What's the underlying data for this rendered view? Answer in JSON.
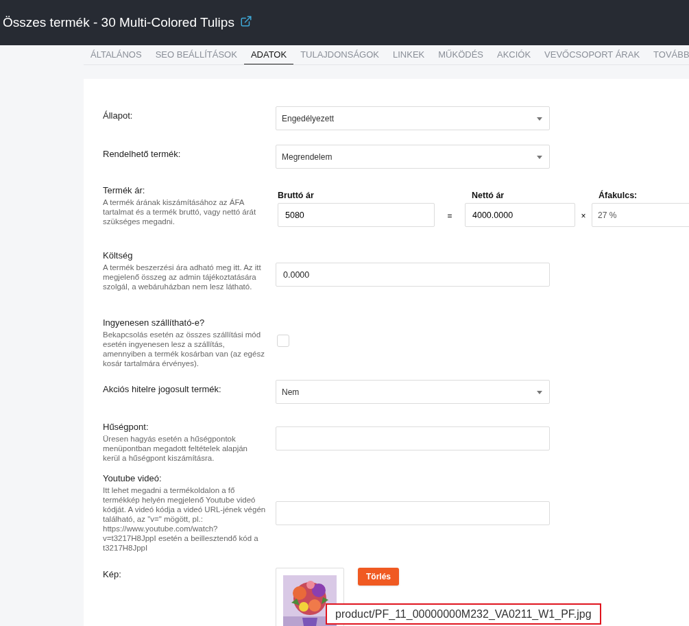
{
  "header": {
    "title": "Összes termék - 30 Multi-Colored Tulips"
  },
  "tabs": [
    {
      "label": "ÁLTALÁNOS",
      "selected": false
    },
    {
      "label": "SEO BEÁLLÍTÁSOK",
      "selected": false
    },
    {
      "label": "ADATOK",
      "selected": true
    },
    {
      "label": "TULAJDONSÁGOK",
      "selected": false
    },
    {
      "label": "LINKEK",
      "selected": false
    },
    {
      "label": "MŰKÖDÉS",
      "selected": false
    },
    {
      "label": "AKCIÓK",
      "selected": false
    },
    {
      "label": "VEVŐCSOPORT ÁRAK",
      "selected": false
    },
    {
      "label": "TOVÁBB",
      "selected": false
    }
  ],
  "fields": [
    {
      "kind": "select",
      "label": "Állapot:",
      "value": "Engedélyezett"
    },
    {
      "kind": "select",
      "label": "Rendelhető termék:",
      "value": "Megrendelem"
    },
    {
      "kind": "price",
      "label": "Termék ár:",
      "help": "A termék árának kiszámításához az ÁFA tartalmat és a termék bruttó, vagy nettó árát szükséges megadni.",
      "gross_label": "Bruttó ár",
      "gross_value": "5080",
      "equals": "=",
      "net_label": "Nettó ár",
      "net_value": "4000.0000",
      "times": "×",
      "vat_label": "Áfakulcs:",
      "vat_value": "27 %"
    },
    {
      "kind": "input",
      "label": "Költség",
      "help": "A termék beszerzési ára adható meg itt. Az itt megjelenő összeg az admin tájékoztatására szolgál, a webáruházban nem lesz látható.",
      "value": "0.0000"
    },
    {
      "kind": "checkbox",
      "label": "Ingyenesen szállítható-e?",
      "help": "Bekapcsolás esetén az összes szállítási mód esetén ingyenesen lesz a szállítás, amennyiben a termék kosárban van (az egész kosár tartalmára érvényes).",
      "checked": false
    },
    {
      "kind": "select",
      "label": "Akciós hitelre jogosult termék:",
      "value": "Nem"
    },
    {
      "kind": "input",
      "label": "Hűségpont:",
      "help": "Üresen hagyás esetén a hűségpontok menüpontban megadott feltételek alapján kerül a hűségpont kiszámításra."
    },
    {
      "kind": "input",
      "label": "Youtube videó:",
      "help": "Itt lehet megadni a termékoldalon a fő termékkép helyén megjelenő Youtube videó kódját. A videó kódja a videó URL-jének végén található, az \"v=\" mögött, pl.: https://www.youtube.com/watch?v=t3217H8JppI esetén a beillesztendő kód a t3217H8JppI"
    },
    {
      "label": "Kép:",
      "button": "Törlés",
      "filename": "product/PF_11_00000000M232_VA0211_W1_PF.jpg"
    }
  ]
}
